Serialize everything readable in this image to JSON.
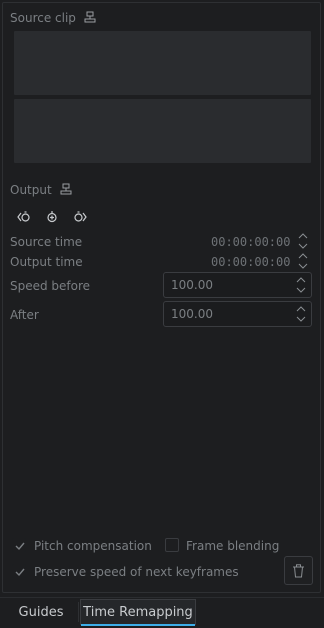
{
  "source_clip": {
    "label": "Source clip",
    "lock_icon": "link-icon"
  },
  "output": {
    "label": "Output",
    "lock_icon": "link-icon"
  },
  "keyframe_buttons": [
    {
      "icon": "previous-keyframe-icon"
    },
    {
      "icon": "add-keyframe-icon"
    },
    {
      "icon": "next-keyframe-icon"
    }
  ],
  "source_time": {
    "label": "Source time",
    "value": "00:00:00:00"
  },
  "output_time": {
    "label": "Output time",
    "value": "00:00:00:00"
  },
  "speed_before": {
    "label": "Speed before",
    "value": "100.00"
  },
  "speed_after": {
    "label": "After",
    "value": "100.00"
  },
  "options": {
    "pitch_compensation": {
      "label": "Pitch compensation",
      "checked": true
    },
    "frame_blending": {
      "label": "Frame blending",
      "checked": false
    },
    "preserve_speed": {
      "label": "Preserve speed of next keyframes",
      "checked": true
    },
    "delete_icon": "trash-icon"
  },
  "tabs": [
    {
      "label": "Guides",
      "active": false
    },
    {
      "label": "Time Remapping",
      "active": true
    }
  ],
  "colors": {
    "accent": "#3daee9",
    "panel_bg": "#1d1e20",
    "clip_bg": "#2a2c2f"
  }
}
